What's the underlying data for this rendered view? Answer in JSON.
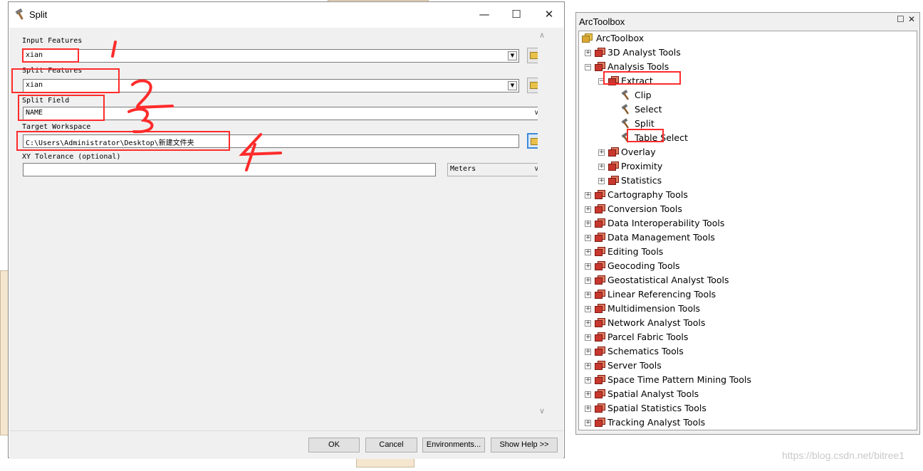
{
  "dialog": {
    "title": "Split",
    "minimize_glyph": "—",
    "maximize_glyph": "☐",
    "close_glyph": "✕",
    "input_features": {
      "label": "Input Features",
      "value": "xian"
    },
    "split_features": {
      "label": "Split Features",
      "value": "xian"
    },
    "split_field": {
      "label": "Split Field",
      "value": "NAME"
    },
    "target_workspace": {
      "label": "Target Workspace",
      "value": "C:\\Users\\Administrator\\Desktop\\新建文件夹"
    },
    "xy_tolerance": {
      "label": "XY Tolerance (optional)",
      "value": "",
      "unit": "Meters"
    },
    "buttons": {
      "ok": "OK",
      "cancel": "Cancel",
      "environments": "Environments...",
      "show_help": "Show Help >>"
    }
  },
  "toolbox": {
    "title": "ArcToolbox",
    "pin_glyph": "☐",
    "close_glyph": "✕",
    "root": "ArcToolbox",
    "items": [
      {
        "label": "3D Analyst Tools"
      },
      {
        "label": "Analysis Tools"
      },
      {
        "label": "Extract"
      },
      {
        "label": "Clip"
      },
      {
        "label": "Select"
      },
      {
        "label": "Split"
      },
      {
        "label": "Table Select"
      },
      {
        "label": "Overlay"
      },
      {
        "label": "Proximity"
      },
      {
        "label": "Statistics"
      },
      {
        "label": "Cartography Tools"
      },
      {
        "label": "Conversion Tools"
      },
      {
        "label": "Data Interoperability Tools"
      },
      {
        "label": "Data Management Tools"
      },
      {
        "label": "Editing Tools"
      },
      {
        "label": "Geocoding Tools"
      },
      {
        "label": "Geostatistical Analyst Tools"
      },
      {
        "label": "Linear Referencing Tools"
      },
      {
        "label": "Multidimension Tools"
      },
      {
        "label": "Network Analyst Tools"
      },
      {
        "label": "Parcel Fabric Tools"
      },
      {
        "label": "Schematics Tools"
      },
      {
        "label": "Server Tools"
      },
      {
        "label": "Space Time Pattern Mining Tools"
      },
      {
        "label": "Spatial Analyst Tools"
      },
      {
        "label": "Spatial Statistics Tools"
      },
      {
        "label": "Tracking Analyst Tools"
      }
    ]
  },
  "annotations": {
    "n1": "1",
    "n2": "2",
    "n3": "3",
    "n4": "4"
  },
  "watermark": "https://blog.csdn.net/bitree1",
  "colors": {
    "annotation": "#ff2b2b",
    "toolbox_icon": "#c8372d",
    "dialog_bg": "#f0f0f0"
  }
}
